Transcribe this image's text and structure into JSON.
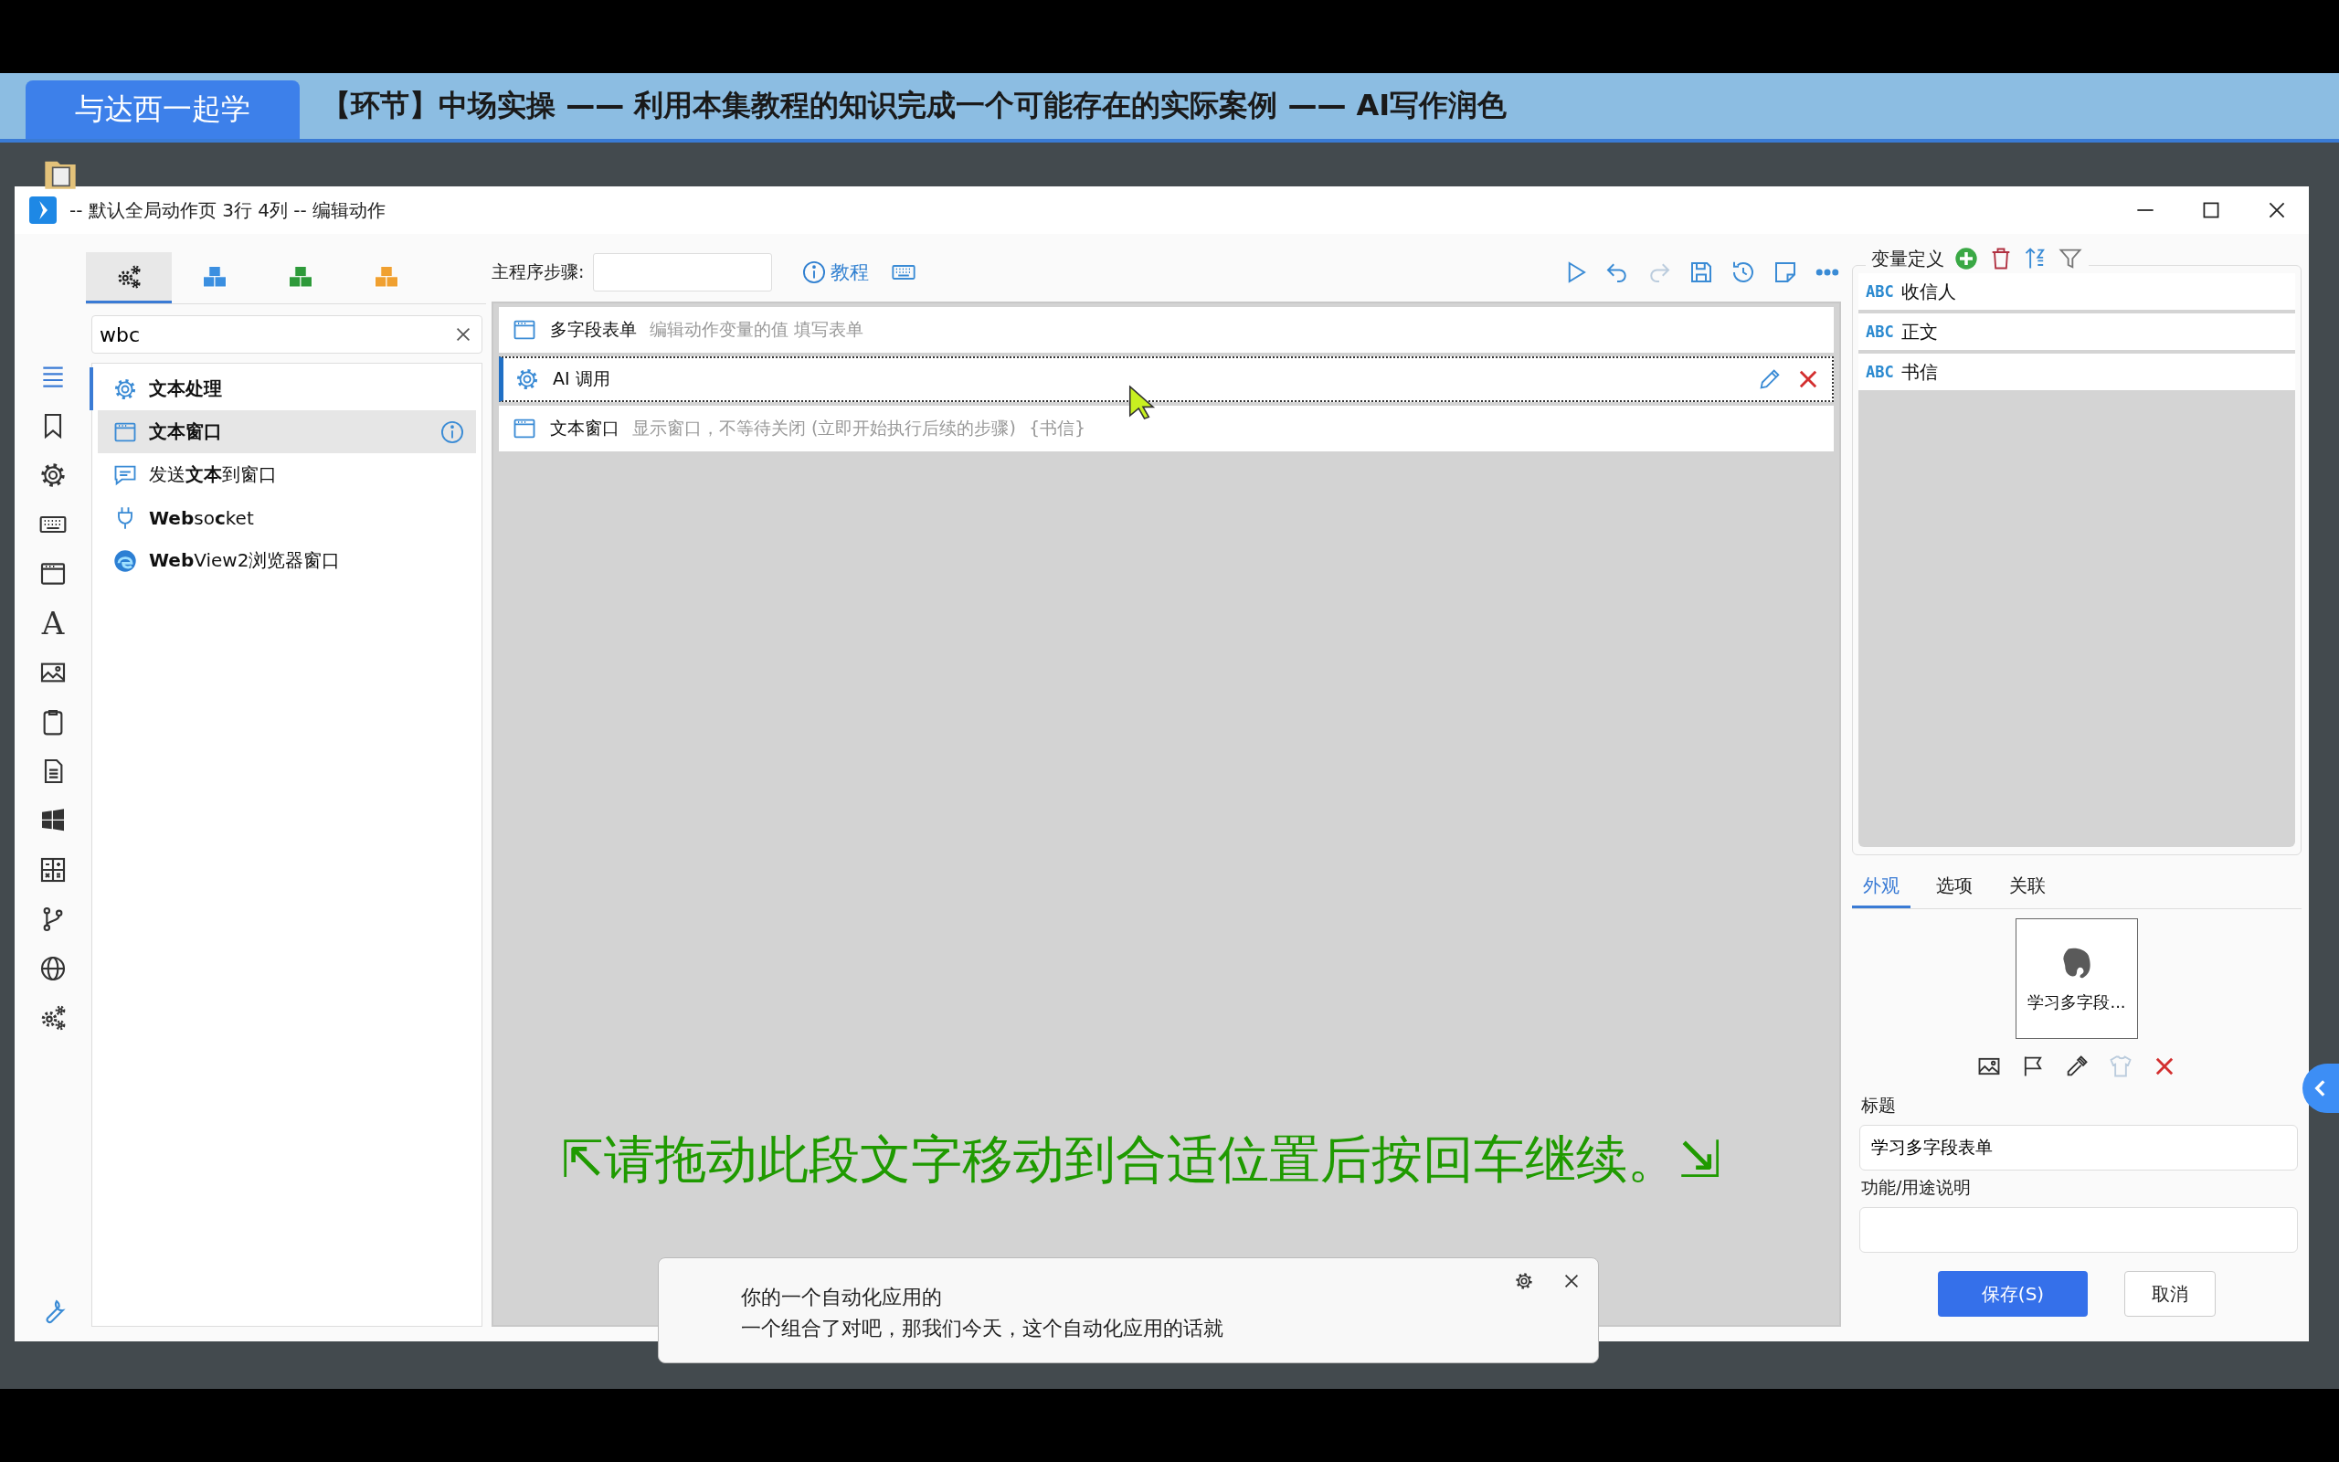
{
  "banner": {
    "badge": "与达西一起学",
    "title": "【环节】中场实操 —— 利用本集教程的知识完成一个可能存在的实际案例 —— AI写作润色"
  },
  "window": {
    "title": "-- 默认全局动作页 3行 4列 -- 编辑动作"
  },
  "tool_tabs": [
    {
      "kind": "gears",
      "selected": true
    },
    {
      "kind": "cubes",
      "color": "#3b8fe0",
      "selected": false
    },
    {
      "kind": "cubes",
      "color": "#2e9a3a",
      "selected": false
    },
    {
      "kind": "cubes",
      "color": "#f0a030",
      "selected": false
    }
  ],
  "rail": [
    {
      "kind": "menu",
      "selected": true
    },
    {
      "kind": "bookmark",
      "selected": false
    },
    {
      "kind": "gear",
      "selected": false
    },
    {
      "kind": "keyboard",
      "selected": false
    },
    {
      "kind": "window",
      "selected": false
    },
    {
      "kind": "font",
      "glyph": "A",
      "selected": false
    },
    {
      "kind": "image",
      "selected": false
    },
    {
      "kind": "clipboard",
      "selected": false
    },
    {
      "kind": "document",
      "selected": false
    },
    {
      "kind": "windows",
      "selected": false
    },
    {
      "kind": "calculator",
      "selected": false
    },
    {
      "kind": "branch",
      "selected": false
    },
    {
      "kind": "globe",
      "selected": false
    },
    {
      "kind": "gears",
      "selected": false
    }
  ],
  "search": {
    "value": "wbc"
  },
  "actions": [
    {
      "kind": "gear",
      "label": "文本处理",
      "bold": true,
      "selected": false
    },
    {
      "kind": "window",
      "label": "文本窗口",
      "bold": true,
      "selected": true
    },
    {
      "kind": "chat",
      "label": "发送**文本**到窗口",
      "bold": false,
      "selected": false
    },
    {
      "kind": "plug",
      "label": "**Web**so**c**ket",
      "bold": false,
      "selected": false
    },
    {
      "kind": "edge",
      "label": "**Web**View2浏览器窗口",
      "bold": false,
      "selected": false
    }
  ],
  "steps_toolbar": {
    "label": "主程序步骤:",
    "tutorial": "教程"
  },
  "steps": [
    {
      "kind": "window",
      "name": "多字段表单",
      "desc": "编辑动作变量的值 填写表单",
      "selected": false
    },
    {
      "kind": "gear",
      "name": "AI 调用",
      "selected": true
    },
    {
      "kind": "window",
      "name": "文本窗口",
      "desc": "显示窗口，不等待关闭 (立即开始执行后续的步骤)",
      "var": "{书信}",
      "selected": false
    }
  ],
  "drag_hint": "⇱请拖动此段文字移动到合适位置后按回车继续。⇲",
  "variables": {
    "title": "变量定义",
    "items": [
      {
        "type": "ABC",
        "name": "收信人"
      },
      {
        "type": "ABC",
        "name": "正文"
      },
      {
        "type": "ABC",
        "name": "书信"
      }
    ]
  },
  "props_tabs": [
    {
      "label": "外观",
      "selected": true
    },
    {
      "label": "选项",
      "selected": false
    },
    {
      "label": "关联",
      "selected": false
    }
  ],
  "preview": {
    "label": "学习多字段..."
  },
  "fields": [
    {
      "label": "标题",
      "value": "学习多字段表单"
    },
    {
      "label": "功能/用途说明"
    }
  ],
  "buttons": [
    {
      "label": "保存(S)",
      "kind": "primary"
    },
    {
      "label": "取消",
      "kind": "secondary"
    }
  ],
  "subtitle": {
    "lines": [
      "你的一个自动化应用的",
      "一个组合了对吧，那我们今天，这个自动化应用的话就"
    ]
  }
}
